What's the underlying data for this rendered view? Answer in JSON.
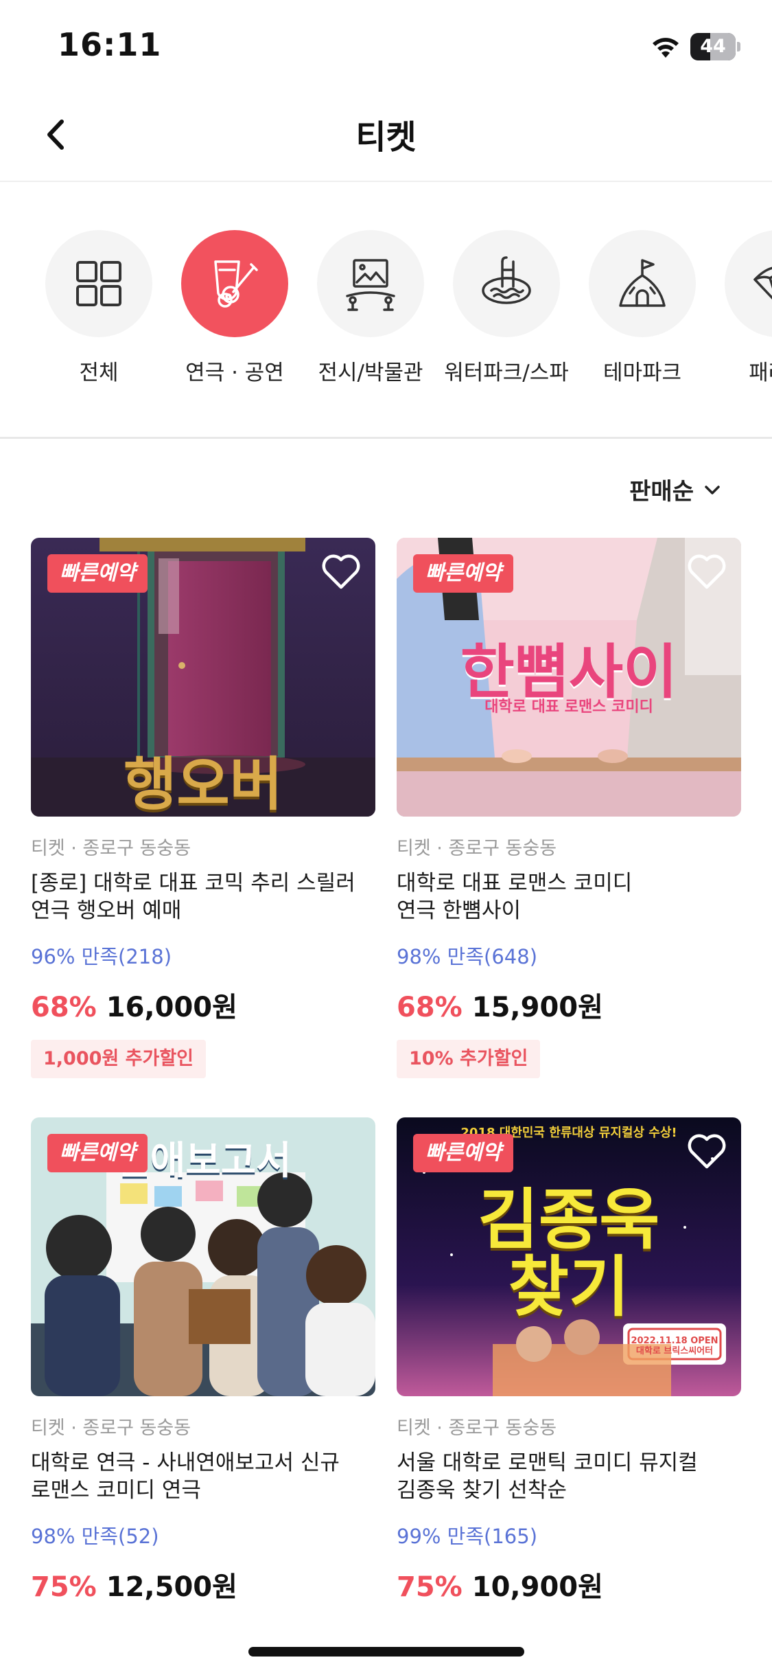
{
  "status_bar": {
    "time": "16:11",
    "battery": "44",
    "battery_level": 0.44
  },
  "header": {
    "title": "티켓"
  },
  "categories": [
    {
      "label": "전체",
      "icon": "grid-icon",
      "active": false
    },
    {
      "label": "연극 · 공연",
      "icon": "guitar-icon",
      "active": true
    },
    {
      "label": "전시/박물관",
      "icon": "exhibition-icon",
      "active": false
    },
    {
      "label": "워터파크/스파",
      "icon": "pool-icon",
      "active": false
    },
    {
      "label": "테마파크",
      "icon": "castle-icon",
      "active": false
    },
    {
      "label": "패러글",
      "icon": "paraglider-icon",
      "active": false
    }
  ],
  "sort": {
    "label": "판매순"
  },
  "products": [
    {
      "badge": "빠른예약",
      "poster_title": "행오버",
      "meta": "티켓 · 종로구 동숭동",
      "name_line1": "[종로] 대학로 대표 코믹 추리 스릴러",
      "name_line2": "연극 행오버 예매",
      "rating": "96% 만족(218)",
      "discount": "68%",
      "price": "16,000원",
      "coupon": "1,000원 추가할인"
    },
    {
      "badge": "빠른예약",
      "poster_title": "한뼘사이",
      "poster_subtitle": "대학로 대표 로맨스 코미디",
      "meta": "티켓 · 종로구 동숭동",
      "name_line1": "대학로 대표 로맨스 코미디",
      "name_line2": "연극 한뼘사이",
      "rating": "98% 만족(648)",
      "discount": "68%",
      "price": "15,900원",
      "coupon": "10% 추가할인"
    },
    {
      "badge": "빠른예약",
      "poster_title": "연애보고서",
      "meta": "티켓 · 종로구 동숭동",
      "name_line1": "대학로 연극 - 사내연애보고서 신규",
      "name_line2": "로맨스 코미디 연극",
      "rating": "98% 만족(52)",
      "discount": "75%",
      "price": "12,500원"
    },
    {
      "badge": "빠른예약",
      "poster_title_line1": "김종욱",
      "poster_title_line2": "찾기",
      "poster_top": "2018 대한민국 한류대상 뮤지컬상 수상!",
      "poster_sign": "2022.11.18 OPEN 대학로 브릭스씨어터",
      "meta": "티켓 · 종로구 동숭동",
      "name_line1": "서울 대학로 로맨틱 코미디 뮤지컬",
      "name_line2": "김종욱 찾기 선착순",
      "rating": "99% 만족(165)",
      "discount": "75%",
      "price": "10,900원"
    }
  ],
  "colors": {
    "accent": "#f0505c",
    "rating": "#5a73d6",
    "coupon_bg": "#fdeeee"
  }
}
